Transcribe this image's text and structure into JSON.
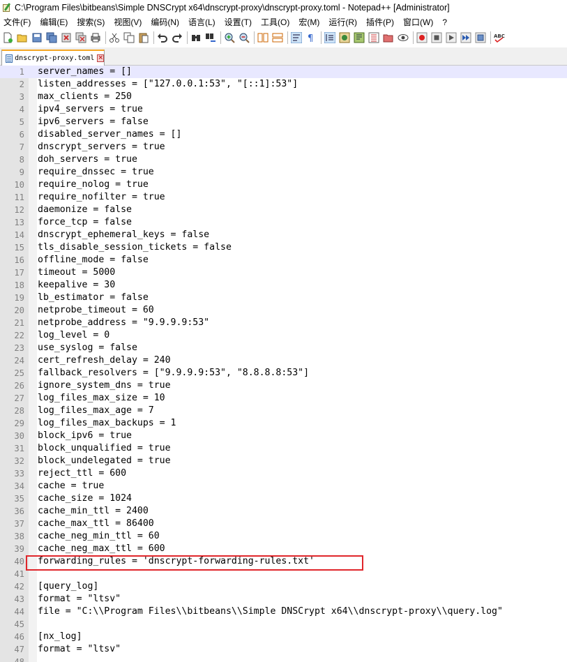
{
  "window": {
    "title": "C:\\Program Files\\bitbeans\\Simple DNSCrypt x64\\dnscrypt-proxy\\dnscrypt-proxy.toml - Notepad++ [Administrator]",
    "app_icon": "notepad-pen-icon"
  },
  "menu": [
    {
      "label": "文件(F)"
    },
    {
      "label": "编辑(E)"
    },
    {
      "label": "搜索(S)"
    },
    {
      "label": "视图(V)"
    },
    {
      "label": "编码(N)"
    },
    {
      "label": "语言(L)"
    },
    {
      "label": "设置(T)"
    },
    {
      "label": "工具(O)"
    },
    {
      "label": "宏(M)"
    },
    {
      "label": "运行(R)"
    },
    {
      "label": "插件(P)"
    },
    {
      "label": "窗口(W)"
    },
    {
      "label": "?"
    }
  ],
  "tab": {
    "label": "dnscrypt-proxy.toml",
    "icon": "file-icon",
    "close_icon": "close-icon"
  },
  "editor": {
    "current_line": 1,
    "highlighted_line": 40,
    "accent_color": "#e0262b",
    "lines": [
      {
        "n": "1",
        "text": "server_names = []"
      },
      {
        "n": "2",
        "text": "listen_addresses = [\"127.0.0.1:53\", \"[::1]:53\"]"
      },
      {
        "n": "3",
        "text": "max_clients = 250"
      },
      {
        "n": "4",
        "text": "ipv4_servers = true"
      },
      {
        "n": "5",
        "text": "ipv6_servers = false"
      },
      {
        "n": "6",
        "text": "disabled_server_names = []"
      },
      {
        "n": "7",
        "text": "dnscrypt_servers = true"
      },
      {
        "n": "8",
        "text": "doh_servers = true"
      },
      {
        "n": "9",
        "text": "require_dnssec = true"
      },
      {
        "n": "10",
        "text": "require_nolog = true"
      },
      {
        "n": "11",
        "text": "require_nofilter = true"
      },
      {
        "n": "12",
        "text": "daemonize = false"
      },
      {
        "n": "13",
        "text": "force_tcp = false"
      },
      {
        "n": "14",
        "text": "dnscrypt_ephemeral_keys = false"
      },
      {
        "n": "15",
        "text": "tls_disable_session_tickets = false"
      },
      {
        "n": "16",
        "text": "offline_mode = false"
      },
      {
        "n": "17",
        "text": "timeout = 5000"
      },
      {
        "n": "18",
        "text": "keepalive = 30"
      },
      {
        "n": "19",
        "text": "lb_estimator = false"
      },
      {
        "n": "20",
        "text": "netprobe_timeout = 60"
      },
      {
        "n": "21",
        "text": "netprobe_address = \"9.9.9.9:53\""
      },
      {
        "n": "22",
        "text": "log_level = 0"
      },
      {
        "n": "23",
        "text": "use_syslog = false"
      },
      {
        "n": "24",
        "text": "cert_refresh_delay = 240"
      },
      {
        "n": "25",
        "text": "fallback_resolvers = [\"9.9.9.9:53\", \"8.8.8.8:53\"]"
      },
      {
        "n": "26",
        "text": "ignore_system_dns = true"
      },
      {
        "n": "27",
        "text": "log_files_max_size = 10"
      },
      {
        "n": "28",
        "text": "log_files_max_age = 7"
      },
      {
        "n": "29",
        "text": "log_files_max_backups = 1"
      },
      {
        "n": "30",
        "text": "block_ipv6 = true"
      },
      {
        "n": "31",
        "text": "block_unqualified = true"
      },
      {
        "n": "32",
        "text": "block_undelegated = true"
      },
      {
        "n": "33",
        "text": "reject_ttl = 600"
      },
      {
        "n": "34",
        "text": "cache = true"
      },
      {
        "n": "35",
        "text": "cache_size = 1024"
      },
      {
        "n": "36",
        "text": "cache_min_ttl = 2400"
      },
      {
        "n": "37",
        "text": "cache_max_ttl = 86400"
      },
      {
        "n": "38",
        "text": "cache_neg_min_ttl = 60"
      },
      {
        "n": "39",
        "text": "cache_neg_max_ttl = 600"
      },
      {
        "n": "40",
        "text": "forwarding_rules = 'dnscrypt-forwarding-rules.txt'"
      },
      {
        "n": "41",
        "text": ""
      },
      {
        "n": "42",
        "text": "[query_log]"
      },
      {
        "n": "43",
        "text": "format = \"ltsv\""
      },
      {
        "n": "44",
        "text": "file = \"C:\\\\Program Files\\\\bitbeans\\\\Simple DNSCrypt x64\\\\dnscrypt-proxy\\\\query.log\""
      },
      {
        "n": "45",
        "text": ""
      },
      {
        "n": "46",
        "text": "[nx_log]"
      },
      {
        "n": "47",
        "text": "format = \"ltsv\""
      },
      {
        "n": "48",
        "text": ""
      }
    ]
  }
}
